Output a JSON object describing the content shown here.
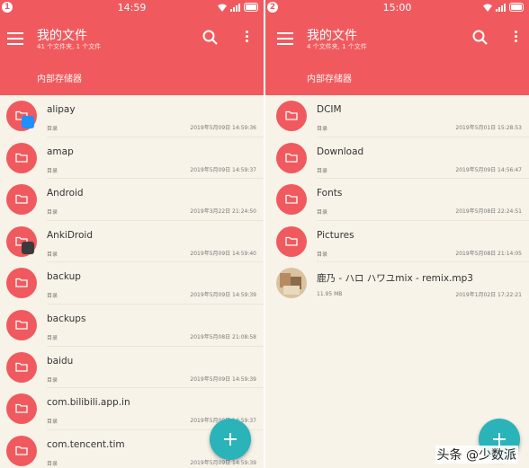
{
  "left": {
    "status": {
      "num": "1",
      "time": "14:59"
    },
    "title": "我的文件",
    "subtitle": "41 个文件夹, 1 个文件",
    "breadcrumb": "内部存储器",
    "items": [
      {
        "name": "alipay",
        "type": "目录",
        "date": "2019年5月09日 14:59:36"
      },
      {
        "name": "amap",
        "type": "目录",
        "date": "2019年5月09日 14:59:37"
      },
      {
        "name": "Android",
        "type": "目录",
        "date": "2019年3月22日 21:24:50"
      },
      {
        "name": "AnkiDroid",
        "type": "目录",
        "date": "2019年5月09日 14:59:40"
      },
      {
        "name": "backup",
        "type": "目录",
        "date": "2019年5月09日 14:59:39"
      },
      {
        "name": "backups",
        "type": "目录",
        "date": "2019年5月08日 21:08:58"
      },
      {
        "name": "baidu",
        "type": "目录",
        "date": "2019年5月09日 14:59:39"
      },
      {
        "name": "com.bilibili.app.in",
        "type": "目录",
        "date": "2019年5月09日 14:59:37"
      },
      {
        "name": "com.tencent.tim",
        "type": "目录",
        "date": "2019年5月09日 14:59:39"
      }
    ]
  },
  "right": {
    "status": {
      "num": "2",
      "time": "15:00"
    },
    "title": "我的文件",
    "subtitle": "4 个文件夹, 1 个文件",
    "breadcrumb": "内部存储器",
    "items": [
      {
        "name": "DCIM",
        "type": "目录",
        "date": "2019年5月01日 15:28:53"
      },
      {
        "name": "Download",
        "type": "目录",
        "date": "2019年5月09日 14:56:47"
      },
      {
        "name": "Fonts",
        "type": "目录",
        "date": "2019年5月08日 22:24:51"
      },
      {
        "name": "Pictures",
        "type": "目录",
        "date": "2019年5月08日 21:14:05"
      },
      {
        "name": "鹿乃 - ハロ ハワユmix - remix.mp3",
        "type": "11.95 MB",
        "date": "2019年1月02日 17:22:21"
      }
    ]
  },
  "watermark": "头条 @少数派",
  "colors": {
    "header": "#f05a5e",
    "folder": "#f05a5e",
    "fab": "#2ab3b9",
    "background": "#f7f3e8"
  },
  "icons": {
    "menu": "menu-icon",
    "search": "search-icon",
    "more": "more-vert-icon",
    "folder": "folder-icon",
    "fab": "add-icon"
  }
}
